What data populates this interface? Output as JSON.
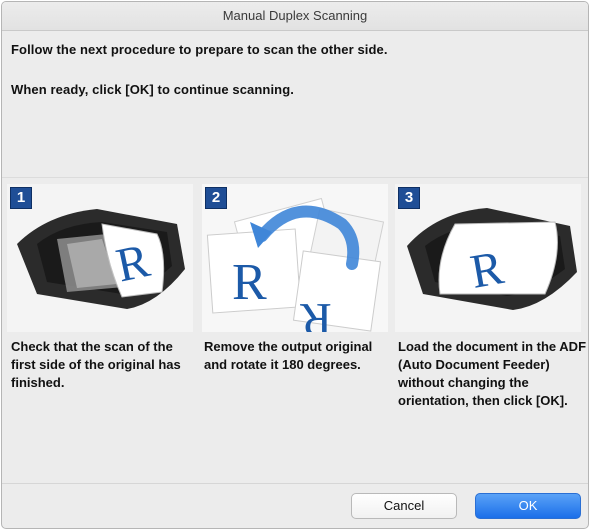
{
  "window": {
    "title": "Manual Duplex Scanning"
  },
  "instructions": {
    "line1": "Follow the next procedure to prepare to scan the other side.",
    "line2": "When ready, click [OK] to continue scanning."
  },
  "steps": [
    {
      "number": "1",
      "caption": "Check that the scan of the first side of the original has finished.",
      "letter": "R"
    },
    {
      "number": "2",
      "caption": "Remove the output original and rotate it 180 degrees.",
      "letter": "R"
    },
    {
      "number": "3",
      "caption": "Load the document in the ADF (Auto Document Feeder) without changing the orientation, then click [OK].",
      "letter": "R"
    }
  ],
  "buttons": {
    "cancel": "Cancel",
    "ok": "OK"
  },
  "colors": {
    "badge": "#1f4e96",
    "letter": "#1c5aa8",
    "ok_button": "#1b6fe9",
    "arrow": "#3f86d8"
  },
  "icons": [
    "scanner-illustration",
    "rotate-arrow-icon"
  ]
}
